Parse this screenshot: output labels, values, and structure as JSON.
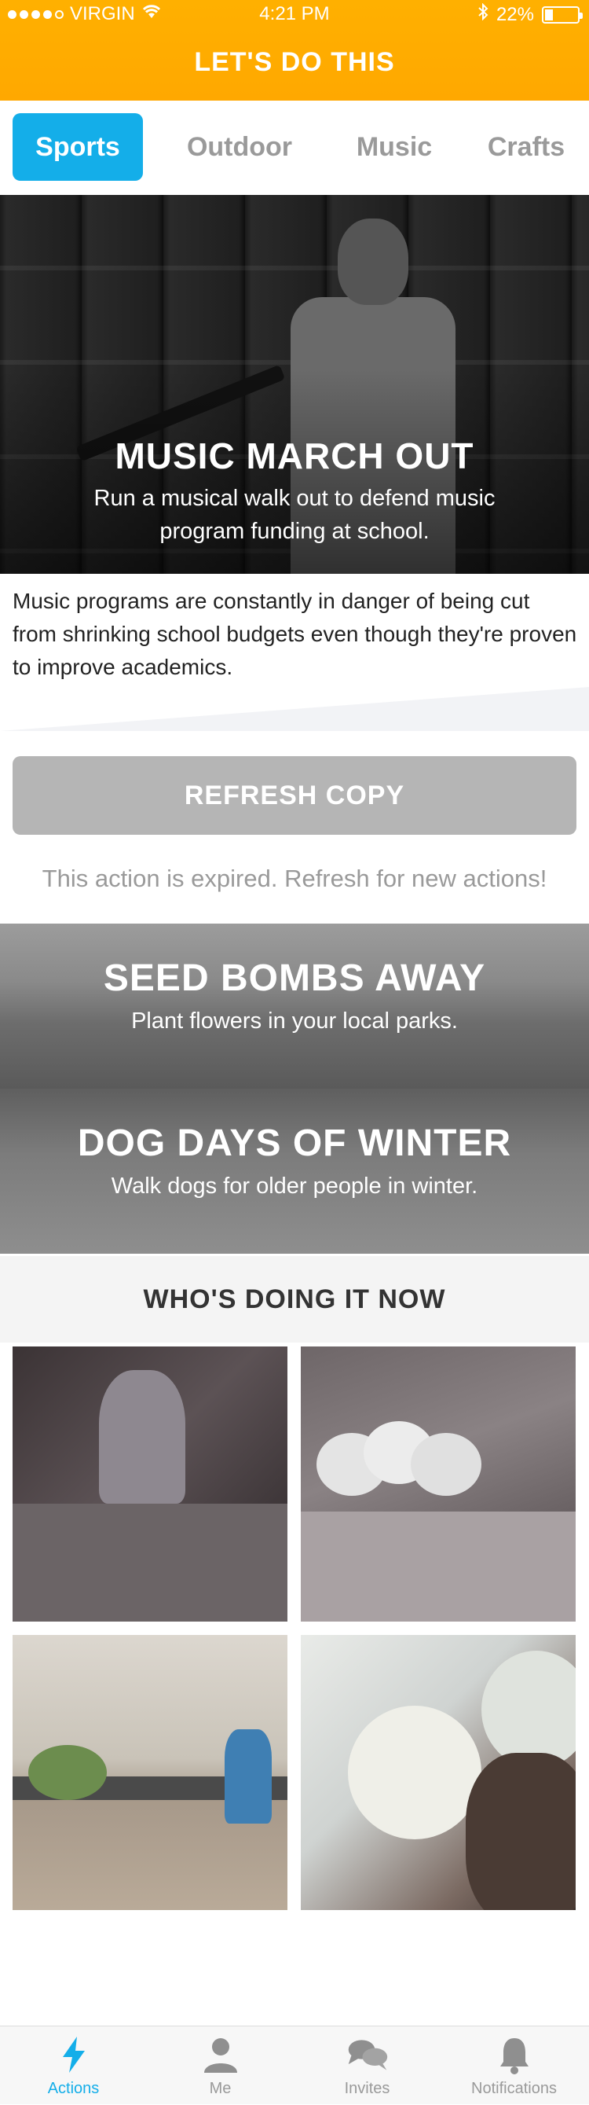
{
  "status_bar": {
    "carrier": "VIRGIN",
    "time": "4:21 PM",
    "battery": "22%"
  },
  "header": {
    "title": "LET'S DO THIS"
  },
  "tabs": [
    {
      "label": "Sports",
      "active": true
    },
    {
      "label": "Outdoor",
      "active": false
    },
    {
      "label": "Music",
      "active": false
    },
    {
      "label": "Crafts",
      "active": false
    }
  ],
  "hero": {
    "title": "MUSIC MARCH OUT",
    "subtitle": "Run a musical walk out to defend music program funding at school."
  },
  "description": "Music programs are constantly in danger of being cut from shrinking school budgets even though they're proven to improve academics.",
  "refresh": {
    "button_label": "REFRESH COPY",
    "expired_text": "This action is expired. Refresh for new actions!"
  },
  "actions": [
    {
      "title": "SEED BOMBS AWAY",
      "subtitle": "Plant flowers in your local parks."
    },
    {
      "title": "DOG DAYS OF WINTER",
      "subtitle": "Walk dogs for older people in winter."
    }
  ],
  "who": {
    "heading": "WHO'S DOING IT NOW"
  },
  "bottom_nav": [
    {
      "label": "Actions",
      "icon": "lightning-icon",
      "active": true
    },
    {
      "label": "Me",
      "icon": "person-icon",
      "active": false
    },
    {
      "label": "Invites",
      "icon": "chat-bubbles-icon",
      "active": false
    },
    {
      "label": "Notifications",
      "icon": "bell-icon",
      "active": false
    }
  ],
  "colors": {
    "header": "#ffa800",
    "accent": "#14aee9",
    "button_disabled": "#b5b5b5"
  }
}
